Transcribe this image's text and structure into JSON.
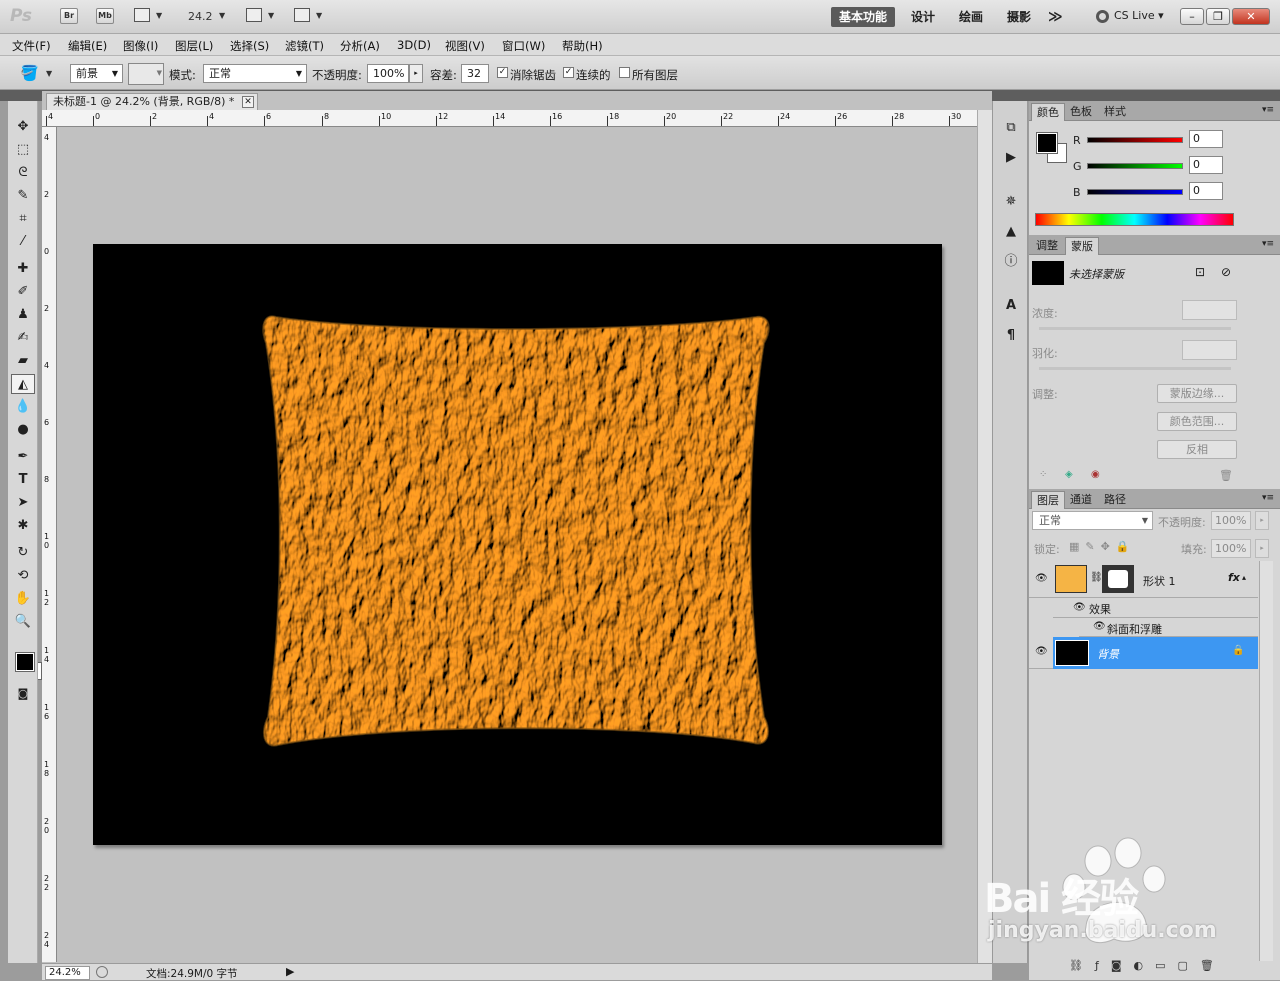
{
  "app": {
    "logo": "Ps",
    "bridge": "Br",
    "minibridge": "Mb",
    "zoom": "24.2",
    "workspaces": [
      "基本功能",
      "设计",
      "绘画",
      "摄影"
    ],
    "overflow": "≫",
    "cslive": "CS Live"
  },
  "menu": [
    "文件(F)",
    "编辑(E)",
    "图像(I)",
    "图层(L)",
    "选择(S)",
    "滤镜(T)",
    "分析(A)",
    "3D(D)",
    "视图(V)",
    "窗口(W)",
    "帮助(H)"
  ],
  "options": {
    "fill_source": "前景",
    "mode_label": "模式:",
    "mode_value": "正常",
    "opacity_label": "不透明度:",
    "opacity_value": "100%",
    "tolerance_label": "容差:",
    "tolerance_value": "32",
    "antialias_label": "消除锯齿",
    "antialias_checked": true,
    "contiguous_label": "连续的",
    "contiguous_checked": true,
    "all_layers_label": "所有图层",
    "all_layers_checked": false
  },
  "document": {
    "tab_title": "未标题-1 @ 24.2% (背景, RGB/8) *",
    "ruler_h": [
      "4",
      "0",
      "2",
      "4",
      "6",
      "8",
      "10",
      "12",
      "14",
      "16",
      "18",
      "20",
      "22",
      "24",
      "26",
      "28",
      "30"
    ],
    "ruler_v": [
      "4",
      "2",
      "0",
      "2",
      "4",
      "6",
      "8",
      "1 0",
      "1 2",
      "1 4",
      "1 6",
      "1 8",
      "2 0",
      "2 2",
      "2 4"
    ],
    "canvas_color": "#000000",
    "shape_color": "#f0b24a"
  },
  "status": {
    "zoom": "24.2%",
    "doc_info": "文档:24.9M/0 字节"
  },
  "color_panel": {
    "tabs": [
      "颜色",
      "色板",
      "样式"
    ],
    "channels": [
      {
        "label": "R",
        "value": "0"
      },
      {
        "label": "G",
        "value": "0"
      },
      {
        "label": "B",
        "value": "0"
      }
    ]
  },
  "masks_panel": {
    "tabs": [
      "调整",
      "蒙版"
    ],
    "no_mask": "未选择蒙版",
    "density_label": "浓度:",
    "feather_label": "羽化:",
    "adjust_label": "调整:",
    "buttons": [
      "蒙版边缘...",
      "颜色范围...",
      "反相"
    ]
  },
  "layers_panel": {
    "tabs": [
      "图层",
      "通道",
      "路径"
    ],
    "blend_mode": "正常",
    "opacity_label": "不透明度:",
    "opacity_value": "100%",
    "lock_label": "锁定:",
    "fill_label": "填充:",
    "fill_value": "100%",
    "layers": [
      {
        "name": "形状 1",
        "fx": "fx",
        "effects_label": "效果",
        "effect": "斜面和浮雕",
        "thumb_color": "#f5b445"
      },
      {
        "name": "背景",
        "selected": true,
        "thumb_color": "#000000"
      }
    ]
  },
  "watermark": {
    "brand": "Bai  经验",
    "url": "jingyan.baidu.com"
  }
}
